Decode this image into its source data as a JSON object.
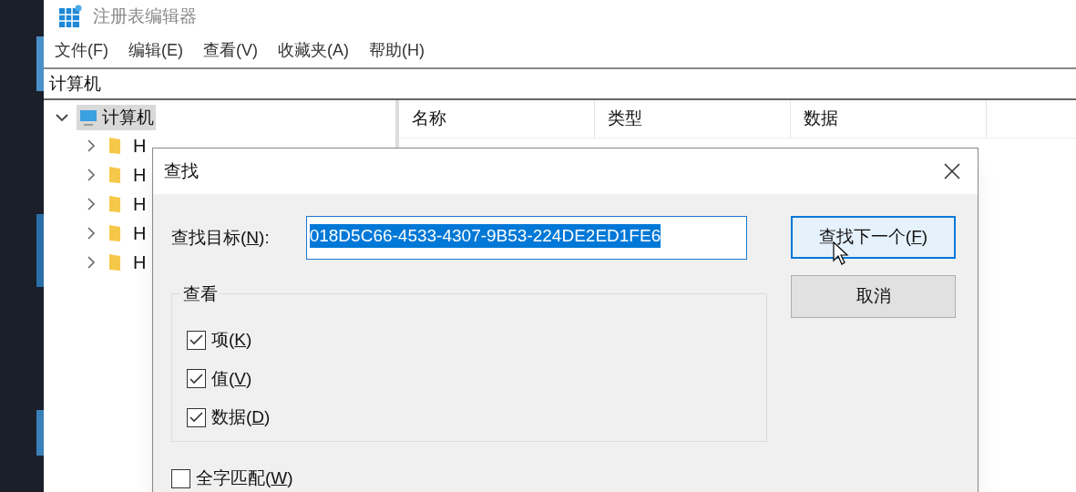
{
  "window": {
    "title": "注册表编辑器"
  },
  "menu": [
    "文件(F)",
    "编辑(E)",
    "查看(V)",
    "收藏夹(A)",
    "帮助(H)"
  ],
  "address": "计算机",
  "tree": {
    "label": "计算机",
    "expanded": true,
    "selected": true,
    "children": [
      {
        "label": "H",
        "expanded": false
      },
      {
        "label": "H",
        "expanded": false
      },
      {
        "label": "H",
        "expanded": false
      },
      {
        "label": "H",
        "expanded": false
      },
      {
        "label": "H",
        "expanded": false
      }
    ]
  },
  "columns": [
    "名称",
    "类型",
    "数据"
  ],
  "dialog": {
    "title": "查找",
    "find_label": {
      "before": "查找目标(",
      "key": "N",
      "after": "):"
    },
    "find_value": "018D5C66-4533-4307-9B53-224DE2ED1FE6",
    "buttons": [
      {
        "before": "查找下一个(",
        "key": "F",
        "after": ")",
        "kind": "default"
      },
      {
        "before": "取消",
        "kind": "normal"
      }
    ],
    "group": {
      "title": "查看",
      "options": [
        {
          "before": "项(",
          "key": "K",
          "after": ")",
          "checked": true
        },
        {
          "before": "值(",
          "key": "V",
          "after": ")",
          "checked": true
        },
        {
          "before": "数据(",
          "key": "D",
          "after": ")",
          "checked": true
        }
      ]
    },
    "whole_word": {
      "before": "全字匹配(",
      "key": "W",
      "after": ")",
      "checked": false
    }
  }
}
